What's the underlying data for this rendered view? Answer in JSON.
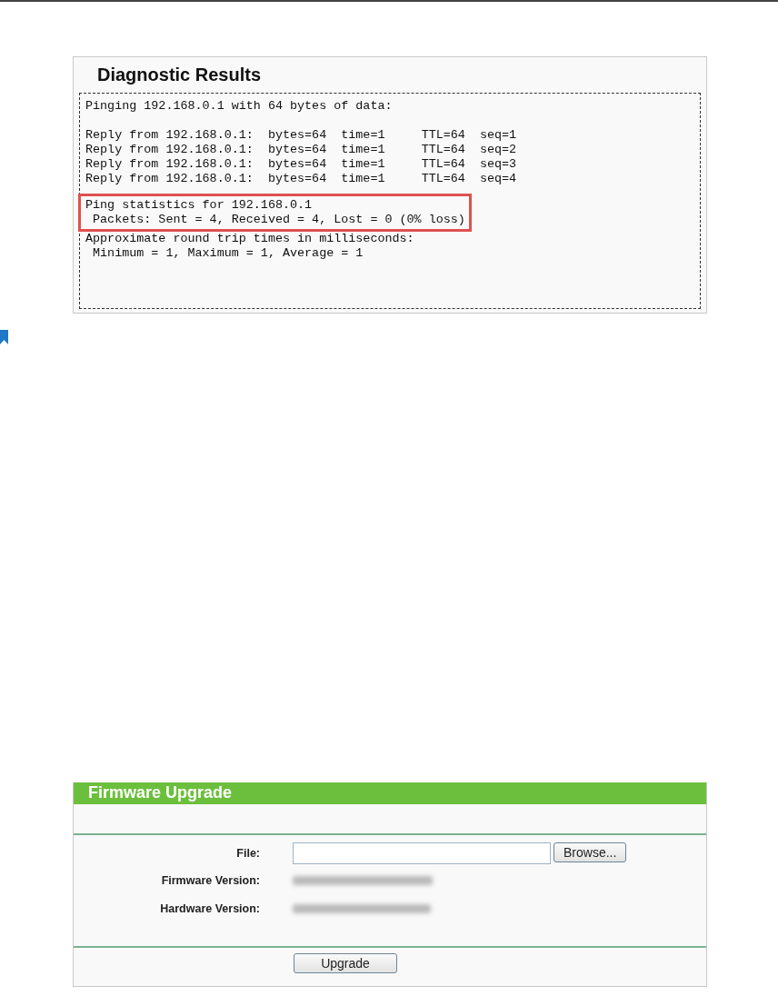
{
  "diagnostic": {
    "title": "Diagnostic Results",
    "intro": "Pinging 192.168.0.1 with 64 bytes of data:",
    "replies": [
      "Reply from 192.168.0.1:  bytes=64  time=1     TTL=64  seq=1",
      "Reply from 192.168.0.1:  bytes=64  time=1     TTL=64  seq=2",
      "Reply from 192.168.0.1:  bytes=64  time=1     TTL=64  seq=3",
      "Reply from 192.168.0.1:  bytes=64  time=1     TTL=64  seq=4"
    ],
    "statistics": [
      "Ping statistics for 192.168.0.1",
      " Packets: Sent = 4, Received = 4, Lost = 0 (0% loss)"
    ],
    "round_trip": [
      "Approximate round trip times in milliseconds:",
      " Minimum = 1, Maximum = 1, Average = 1"
    ]
  },
  "firmware": {
    "title": "Firmware Upgrade",
    "fields": [
      {
        "label": "File:",
        "kind": "file",
        "button": "Browse..."
      },
      {
        "label": "Firmware Version:",
        "kind": "blurred"
      },
      {
        "label": "Hardware Version:",
        "kind": "blurred"
      }
    ],
    "submit": "Upgrade"
  }
}
